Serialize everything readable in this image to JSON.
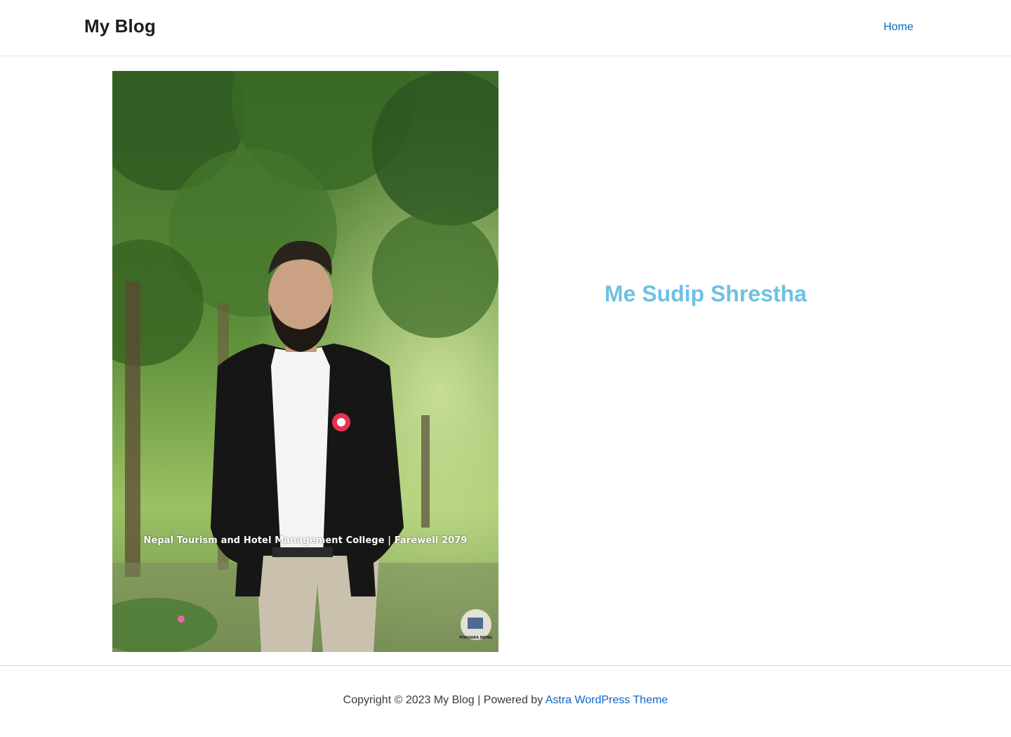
{
  "header": {
    "site_title": "My Blog",
    "nav": [
      {
        "label": "Home"
      }
    ]
  },
  "main": {
    "photo_caption": "Nepal Tourism and Hotel Management College | Farewell 2079",
    "photo_watermark": "POKHARA NEPAL",
    "heading": "Me Sudip Shrestha"
  },
  "footer": {
    "copyright": "Copyright © 2023 My Blog | Powered by",
    "theme_link": "Astra WordPress Theme"
  },
  "colors": {
    "heading_accent": "#6ec1e4",
    "link": "#0a66c2",
    "text": "#3a3a3a"
  }
}
